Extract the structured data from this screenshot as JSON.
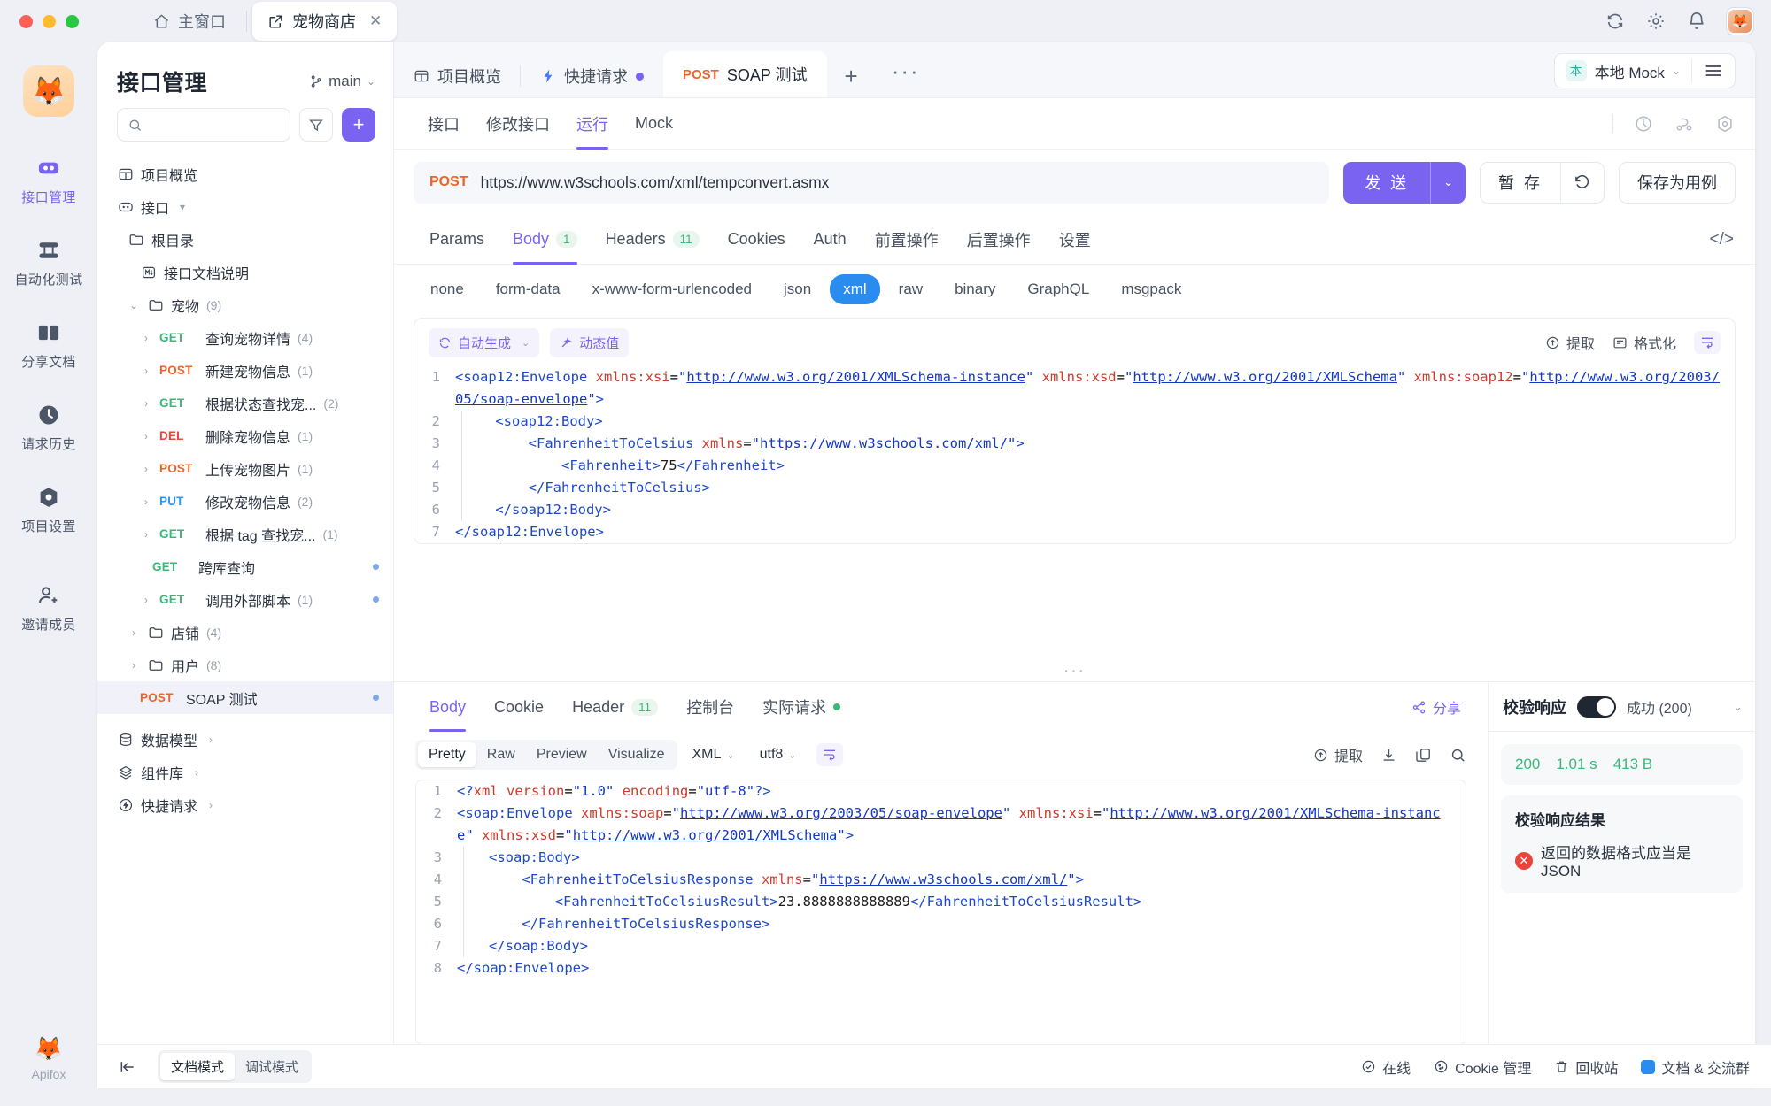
{
  "window": {
    "tabs": [
      {
        "label": "主窗口",
        "icon": "home-icon",
        "active": false
      },
      {
        "label": "宠物商店",
        "icon": "external-link-icon",
        "active": true
      }
    ],
    "right_icons": [
      "sync-icon",
      "gear-icon",
      "bell-icon",
      "avatar"
    ]
  },
  "rail": {
    "logo": "fox-logo",
    "items": [
      {
        "label": "接口管理",
        "icon": "api-icon",
        "active": true
      },
      {
        "label": "自动化测试",
        "icon": "automation-icon",
        "active": false
      },
      {
        "label": "分享文档",
        "icon": "book-icon",
        "active": false
      },
      {
        "label": "请求历史",
        "icon": "clock-icon",
        "active": false
      },
      {
        "label": "项目设置",
        "icon": "settings-icon",
        "active": false
      },
      {
        "label": "邀请成员",
        "icon": "user-plus-icon",
        "active": false
      }
    ],
    "brand": "Apifox"
  },
  "sidebar": {
    "title": "接口管理",
    "branch": "main",
    "search_placeholder": "",
    "search_value": "",
    "filter_icon": "filter-icon",
    "add_label": "+",
    "tree": [
      {
        "label": "项目概览",
        "icon": "overview-icon",
        "indent": 0,
        "type": "node"
      },
      {
        "label": "接口",
        "icon": "api-badge-icon",
        "indent": 0,
        "type": "node",
        "caret": "▾"
      },
      {
        "label": "根目录",
        "icon": "folder-code-icon",
        "indent": 1,
        "type": "node"
      },
      {
        "label": "接口文档说明",
        "icon": "markdown-icon",
        "indent": 2,
        "type": "node"
      },
      {
        "label": "宠物",
        "icon": "folder-icon",
        "indent": 1,
        "type": "folder",
        "count": "(9)",
        "caret": "⌄"
      },
      {
        "method": "GET",
        "label": "查询宠物详情",
        "count": "(4)",
        "indent": 2,
        "type": "api"
      },
      {
        "method": "POST",
        "label": "新建宠物信息",
        "count": "(1)",
        "indent": 2,
        "type": "api"
      },
      {
        "method": "GET",
        "label": "根据状态查找宠...",
        "count": "(2)",
        "indent": 2,
        "type": "api"
      },
      {
        "method": "DEL",
        "label": "删除宠物信息",
        "count": "(1)",
        "indent": 2,
        "type": "api"
      },
      {
        "method": "POST",
        "label": "上传宠物图片",
        "count": "(1)",
        "indent": 2,
        "type": "api"
      },
      {
        "method": "PUT",
        "label": "修改宠物信息",
        "count": "(2)",
        "indent": 2,
        "type": "api"
      },
      {
        "method": "GET",
        "label": "根据 tag 查找宠...",
        "count": "(1)",
        "indent": 2,
        "type": "api"
      },
      {
        "method": "GET",
        "label": "跨库查询",
        "count": "",
        "indent": 3,
        "type": "api",
        "dot": true
      },
      {
        "method": "GET",
        "label": "调用外部脚本",
        "count": "(1)",
        "indent": 2,
        "type": "api",
        "dot": true
      },
      {
        "label": "店铺",
        "icon": "folder-icon",
        "indent": 1,
        "type": "folder",
        "count": "(4)",
        "caret": "›"
      },
      {
        "label": "用户",
        "icon": "folder-icon",
        "indent": 1,
        "type": "folder",
        "count": "(8)",
        "caret": "›"
      },
      {
        "method": "POST",
        "label": "SOAP 测试",
        "count": "",
        "indent": 2,
        "type": "api",
        "dot": true,
        "selected": true
      },
      {
        "label": "数据模型",
        "icon": "model-icon",
        "indent": 0,
        "type": "node",
        "caret": "›"
      },
      {
        "label": "组件库",
        "icon": "components-icon",
        "indent": 0,
        "type": "node",
        "caret": "›"
      },
      {
        "label": "快捷请求",
        "icon": "bolt-circle-icon",
        "indent": 0,
        "type": "node",
        "caret": "›"
      }
    ]
  },
  "main": {
    "request_tabs": [
      {
        "label": "项目概览",
        "icon": "overview-icon",
        "active": false,
        "dot": false
      },
      {
        "label": "快捷请求",
        "icon": "bolt-icon",
        "active": false,
        "dot": true
      },
      {
        "label": "SOAP 测试",
        "method": "POST",
        "active": true,
        "dot": false
      }
    ],
    "tab_plus": "+",
    "tab_more": "···",
    "env": {
      "badge": "本",
      "label": "本地 Mock",
      "caret": "⌄",
      "menu_icon": "menu-icon"
    },
    "subtabs": [
      {
        "label": "接口",
        "active": false
      },
      {
        "label": "修改接口",
        "active": false
      },
      {
        "label": "运行",
        "active": true
      },
      {
        "label": "Mock",
        "active": false
      }
    ],
    "subtabs_right_icons": [
      "run-settings-icon",
      "branch-icon",
      "gear-circle-icon"
    ],
    "url": {
      "method": "POST",
      "value": "https://www.w3schools.com/xml/tempconvert.asmx"
    },
    "send_button": {
      "label": "发 送",
      "caret": "⌄"
    },
    "save_button": {
      "label": "暂 存",
      "icon": "revert-icon"
    },
    "save_as_case_button": "保存为用例",
    "req_tabs": [
      {
        "label": "Params",
        "badge": "",
        "active": false
      },
      {
        "label": "Body",
        "badge": "1",
        "active": true
      },
      {
        "label": "Headers",
        "badge": "11",
        "active": false
      },
      {
        "label": "Cookies",
        "badge": "",
        "active": false
      },
      {
        "label": "Auth",
        "badge": "",
        "active": false
      },
      {
        "label": "前置操作",
        "badge": "",
        "active": false
      },
      {
        "label": "后置操作",
        "badge": "",
        "active": false
      },
      {
        "label": "设置",
        "badge": "",
        "active": false
      }
    ],
    "code_icon": "</>",
    "body_types": [
      {
        "label": "none",
        "active": false
      },
      {
        "label": "form-data",
        "active": false
      },
      {
        "label": "x-www-form-urlencoded",
        "active": false
      },
      {
        "label": "json",
        "active": false
      },
      {
        "label": "xml",
        "active": true
      },
      {
        "label": "raw",
        "active": false
      },
      {
        "label": "binary",
        "active": false
      },
      {
        "label": "GraphQL",
        "active": false
      },
      {
        "label": "msgpack",
        "active": false
      }
    ],
    "editor_tools": {
      "auto_generate": "自动生成",
      "auto_generate_caret": "⌄",
      "dynamic_value": "动态值",
      "extract": "提取",
      "format": "格式化",
      "wrap_icon": "wrap-icon"
    },
    "request_body_lines": [
      {
        "no": "1"
      },
      {
        "no": "2"
      },
      {
        "no": "3"
      },
      {
        "no": "4"
      },
      {
        "no": "5"
      },
      {
        "no": "6"
      },
      {
        "no": "7"
      }
    ]
  },
  "response": {
    "tabs": [
      {
        "label": "Body",
        "badge": "",
        "active": true,
        "dot": false
      },
      {
        "label": "Cookie",
        "badge": "",
        "active": false,
        "dot": false
      },
      {
        "label": "Header",
        "badge": "11",
        "active": false,
        "dot": false
      },
      {
        "label": "控制台",
        "badge": "",
        "active": false,
        "dot": false
      },
      {
        "label": "实际请求",
        "badge": "",
        "active": false,
        "dot": true
      }
    ],
    "share": "分享",
    "view_modes": [
      {
        "label": "Pretty",
        "active": true
      },
      {
        "label": "Raw",
        "active": false
      },
      {
        "label": "Preview",
        "active": false
      },
      {
        "label": "Visualize",
        "active": false
      }
    ],
    "format_select": {
      "label": "XML",
      "caret": "⌄"
    },
    "encoding_select": {
      "label": "utf8",
      "caret": "⌄"
    },
    "wrap_icon": "wrap-icon",
    "tools": {
      "extract": "提取",
      "download_icon": "download-icon",
      "copy_icon": "copy-icon",
      "search_icon": "search-icon"
    },
    "body_lines": [
      {
        "no": "1"
      },
      {
        "no": "2"
      },
      {
        "no": "3"
      },
      {
        "no": "4"
      },
      {
        "no": "5"
      },
      {
        "no": "6"
      },
      {
        "no": "7"
      },
      {
        "no": "8"
      }
    ]
  },
  "validation": {
    "title": "校验响应",
    "toggle_on": true,
    "status": "成功 (200)",
    "collapse_caret": "⌄",
    "metrics": [
      "200",
      "1.01 s",
      "413 B"
    ],
    "result_title": "校验响应结果",
    "result_message": "返回的数据格式应当是 JSON",
    "result_icon": "error-icon"
  },
  "statusbar": {
    "collapse_icon": "collapse-left-icon",
    "modes": [
      {
        "label": "文档模式",
        "active": true
      },
      {
        "label": "调试模式",
        "active": false
      }
    ],
    "right": [
      {
        "label": "在线",
        "icon": "online-icon"
      },
      {
        "label": "Cookie 管理",
        "icon": "cookie-icon"
      },
      {
        "label": "回收站",
        "icon": "trash-icon"
      },
      {
        "label": "文档 & 交流群",
        "icon": "chat-icon"
      }
    ]
  },
  "colors": {
    "accent": "#7a63f0",
    "blue": "#2b8cf0",
    "green": "#3ab87a",
    "orange": "#e8662c",
    "red": "#e8453c"
  }
}
